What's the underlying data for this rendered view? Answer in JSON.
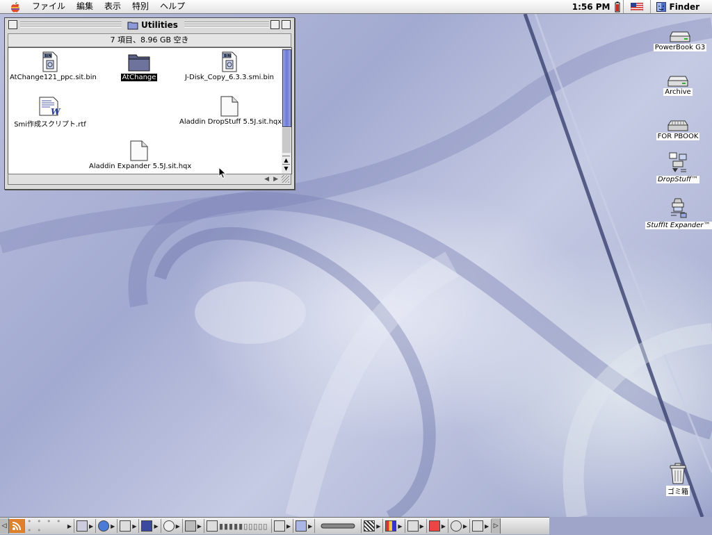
{
  "menubar": {
    "items": [
      "ファイル",
      "編集",
      "表示",
      "特別",
      "ヘルプ"
    ],
    "clock": "1:56 PM",
    "app_name": "Finder",
    "apple_icon": "apple-menu-icon"
  },
  "window": {
    "title": "Utilities",
    "header": "7 項目、8.96 GB 空き",
    "items": [
      {
        "name": "AtChange121_ppc.sit.bin",
        "icon": "bin-file-icon",
        "selected": false
      },
      {
        "name": "AtChange",
        "icon": "folder-icon",
        "selected": true
      },
      {
        "name": "J-Disk_Copy_6.3.3.smi.bin",
        "icon": "bin-file-icon",
        "selected": false
      },
      {
        "name": "Smi作成スクリプト.rtf",
        "icon": "rtf-document-icon",
        "selected": false
      },
      {
        "name": "Aladdin DropStuff 5.5J.sit.hqx",
        "icon": "generic-document-icon",
        "selected": false
      },
      {
        "name": "Aladdin Expander 5.5J.sit.hqx",
        "icon": "generic-document-icon",
        "selected": false
      }
    ]
  },
  "desktop": {
    "icons": [
      {
        "name": "PowerBook G3",
        "icon": "hard-disk-icon"
      },
      {
        "name": "Archive",
        "icon": "hard-disk-icon"
      },
      {
        "name": "FOR PBOOK",
        "icon": "network-volume-icon"
      },
      {
        "name": "DropStuff™",
        "icon": "dropstuff-alias-icon"
      },
      {
        "name": "StuffIt Expander™",
        "icon": "stuffit-expander-alias-icon"
      },
      {
        "name": "ゴミ箱",
        "icon": "trash-icon"
      }
    ]
  },
  "control_strip": {
    "modules": [
      "rss-icon",
      "appletalk-icon",
      "monitor-icon",
      "quicktime-icon",
      "printer-icon",
      "keyboard-icon",
      "cd-icon",
      "lock-icon",
      "energy-icon",
      "sound-level-icon",
      "printer-select-icon",
      "file-sharing-icon",
      "location-icon",
      "color-depth-icon",
      "resolution-icon",
      "remote-access-icon",
      "web-sharing-icon",
      "speech-icon",
      "volume-icon"
    ]
  },
  "colors": {
    "desktop": "#a3aad1",
    "selection": "#000000",
    "scroll_thumb": "#6b78d6"
  }
}
